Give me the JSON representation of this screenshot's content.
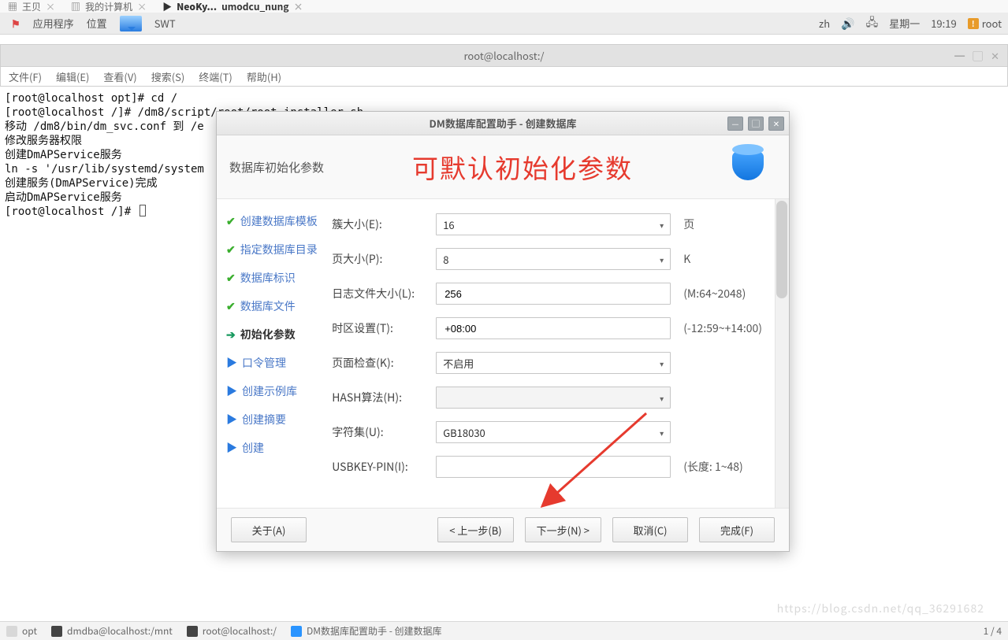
{
  "top_tabs": {
    "t1": "王贝",
    "t2": "我的计算机",
    "active_prefix": "NeoKy...",
    "active_suffix": "umodcu_nung"
  },
  "gnome": {
    "apps": "应用程序",
    "loc": "位置",
    "swt": "SWT",
    "lang": "zh",
    "day": "星期一",
    "time": "19:19",
    "user": "root"
  },
  "terminal": {
    "title": "root@localhost:/",
    "menu": {
      "file": "文件(F)",
      "edit": "编辑(E)",
      "view": "查看(V)",
      "search": "搜索(S)",
      "term": "终端(T)",
      "help": "帮助(H)"
    },
    "lines": "[root@localhost opt]# cd /\n[root@localhost /]# /dm8/script/root/root_installer.sh\n移动 /dm8/bin/dm_svc.conf 到 /e\n修改服务器权限\n创建DmAPService服务\nln -s '/usr/lib/systemd/system                                                                         rvice'\n创建服务(DmAPService)完成\n启动DmAPService服务\n[root@localhost /]# "
  },
  "dialog": {
    "title": "DM数据库配置助手 - 创建数据库",
    "step_title": "数据库初始化参数",
    "annotation": "可默认初始化参数",
    "steps": {
      "s1": "创建数据库模板",
      "s2": "指定数据库目录",
      "s3": "数据库标识",
      "s4": "数据库文件",
      "s5": "初始化参数",
      "s6": "口令管理",
      "s7": "创建示例库",
      "s8": "创建摘要",
      "s9": "创建"
    },
    "form": {
      "cluster_label": "簇大小(E):",
      "cluster_value": "16",
      "cluster_unit": "页",
      "page_label": "页大小(P):",
      "page_value": "8",
      "page_unit": "K",
      "log_label": "日志文件大小(L):",
      "log_value": "256",
      "log_hint": "(M:64~2048)",
      "tz_label": "时区设置(T):",
      "tz_value": "+08:00",
      "tz_hint": "(-12:59~+14:00)",
      "check_label": "页面检查(K):",
      "check_value": "不启用",
      "hash_label": "HASH算法(H):",
      "hash_value": "",
      "charset_label": "字符集(U):",
      "charset_value": "GB18030",
      "usb_label": "USBKEY-PIN(I):",
      "usb_value": "",
      "usb_hint": "(长度: 1~48)"
    },
    "buttons": {
      "about": "关于(A)",
      "prev": "< 上一步(B)",
      "next": "下一步(N) >",
      "cancel": "取消(C)",
      "finish": "完成(F)"
    }
  },
  "taskbar": {
    "t1": "opt",
    "t2": "dmdba@localhost:/mnt",
    "t3": "root@localhost:/",
    "t4": "DM数据库配置助手 - 创建数据库",
    "page": "1 / 4"
  },
  "watermark": "https://blog.csdn.net/qq_36291682"
}
